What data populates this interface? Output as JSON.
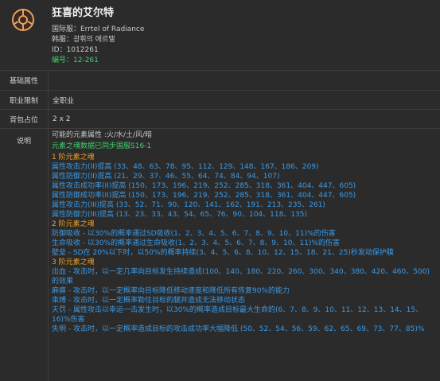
{
  "header": {
    "title": "狂喜的艾尔特",
    "cn_name": "国际服：Errtel of Radiance",
    "kr_name": "韩服：광휘의 에르텔",
    "id": "ID：1012261",
    "code": "编号：12-261"
  },
  "rows": {
    "base_attr_label": "基础属性",
    "base_attr_value": "",
    "job_label": "职业限制",
    "job_value": "全职业",
    "bag_label": "背包占位",
    "bag_value": "2 x 2",
    "desc_label": "说明"
  },
  "description": {
    "elements": "可能的元素属性 :火/水/土/风/暗",
    "sync": "元素之魂数据已同步国服S16-1",
    "tier1_title": "1 阶元素之魂",
    "tier1": [
      "属性攻击力(II)提高 (33、48、63、78、95、112、129、148、167、186、209)",
      "属性防御力(II)提高 (21、29、37、46、55、64、74、84、94、107)",
      "属性攻击成功率(II)提高 (150、173、196、219、252、285、318、361、404、447、605)",
      "属性防御成功率(II)提高 (150、173、196、219、252、285、318、361、404、447、605)",
      "属性攻击力(III)提高 (33、52、71、90、120、141、162、191、213、235、261)",
      "属性防御力(III)提高 (13、23、33、43、54、65、76、90、104、118、135)"
    ],
    "tier2_title": "2 阶元素之魂",
    "tier2": [
      "防御吸收 - 以30%的概率通过SD吸收(1、2、3、4、5、6、7、8、9、10、11)%的伤害",
      "生命吸收 - 以30%的概率通过生命吸收(1、2、3、4、5、6、7、8、9、10、11)%的伤害",
      "壁垒 - SD在 20%以下时，以50%的概率持续(3、4、5、6、8、10、12、15、18、21、25)秒发动保护膜"
    ],
    "tier3_title": "3 阶元素之魂",
    "tier3": [
      "出血 - 攻击时，以一定几率向目标发生持续造成(100、140、180、220、260、300、340、380、420、460、500)的效果",
      "麻痹 - 攻击时，以一定概率向目标降低移动速度和降低所有恢复90%的能力",
      "束缚 - 攻击时，以一定概率勒住目标的腿并造成无法移动状态",
      "天罚 - 属性攻击以幸运一击发生时，以30%的概率造成目标最大生命的(6、7、8、9、10、11、12、13、14、15、16)%伤害",
      "失明 - 攻击时，以一定概率造成目标的攻击成功率大幅降低 (50、52、54、56、59、62、65、69、73、77、85)%"
    ]
  },
  "colors": {
    "background": "#2b2b2b",
    "green": "#3fd06a",
    "orange": "#f0a020",
    "blue": "#3a9ae8",
    "emblem": "#e8a060"
  },
  "icons": {
    "item": "radiance-emblem-icon"
  }
}
